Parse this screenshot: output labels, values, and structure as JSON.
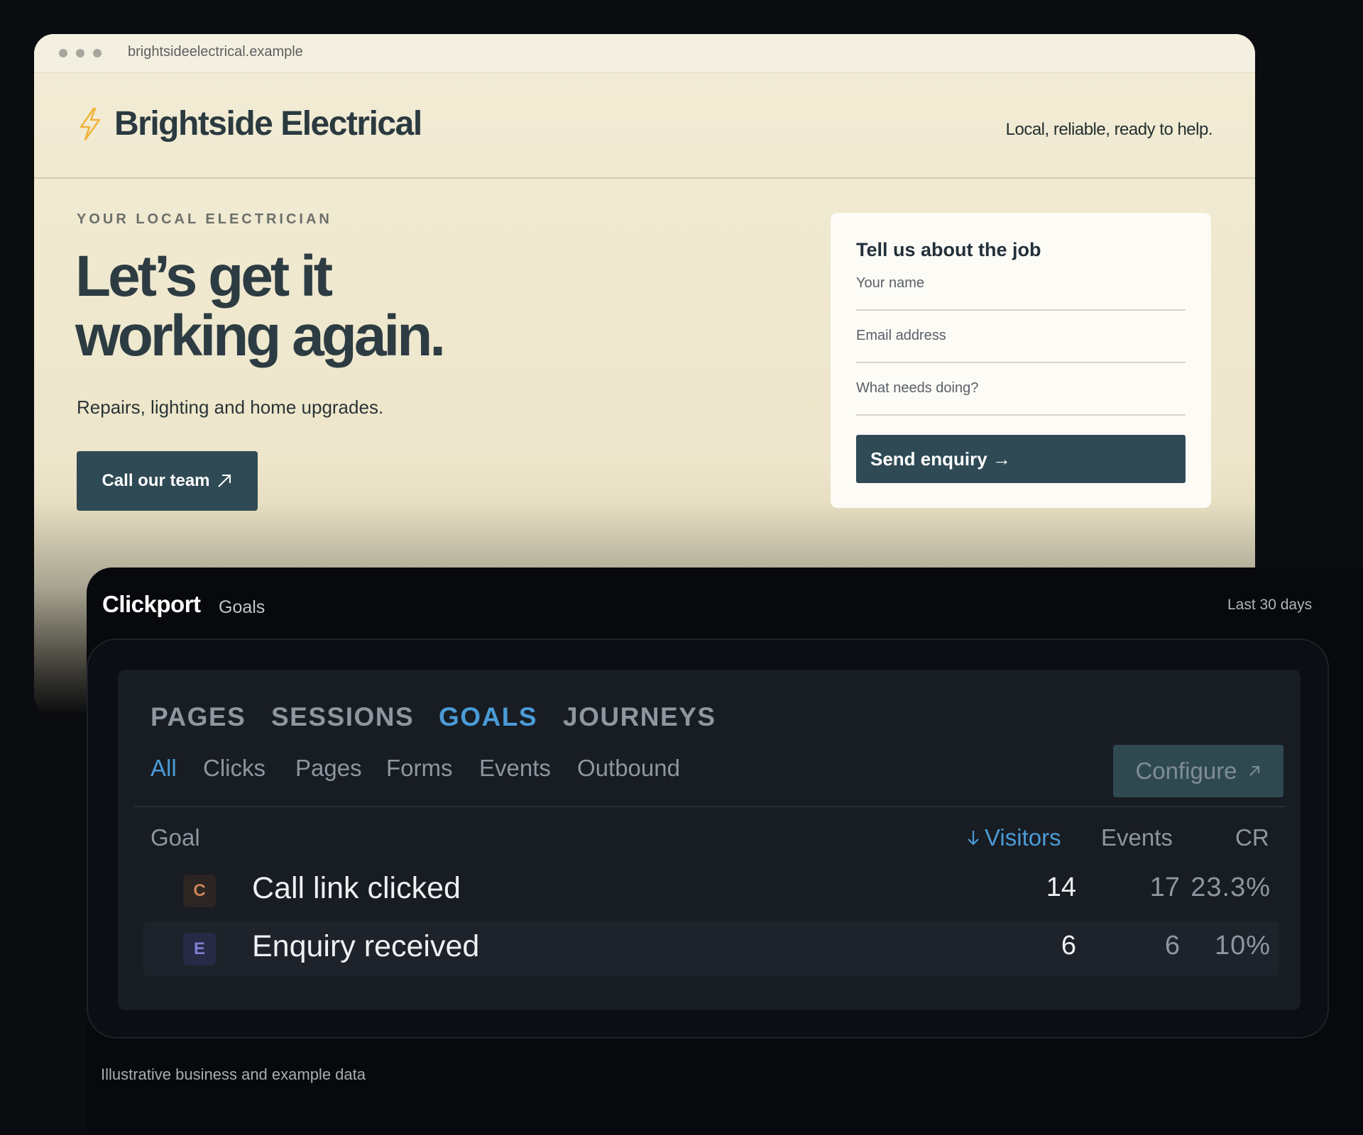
{
  "browser": {
    "url": "brightsideelectrical.example"
  },
  "site": {
    "brand": "Brightside Electrical",
    "tagline": "Local, reliable, ready to help.",
    "eyebrow": "YOUR LOCAL ELECTRICIAN",
    "hero_line1": "Let’s get it",
    "hero_line2": "working again.",
    "subtitle": "Repairs, lighting and home upgrades.",
    "cta_label": "Call our team",
    "cta_icon": "arrow-up-right-icon",
    "accent_color": "#f2b23a",
    "button_color": "#2f4a54"
  },
  "form": {
    "title": "Tell us about the job",
    "name_placeholder": "Your name",
    "email_placeholder": "Email address",
    "message_placeholder": "What needs doing?",
    "submit_label": "Send enquiry →"
  },
  "analytics": {
    "app_name": "Clickport",
    "section": "Goals",
    "range": "Last 30 days",
    "tabs": [
      {
        "label": "PAGES",
        "active": false
      },
      {
        "label": "SESSIONS",
        "active": false
      },
      {
        "label": "GOALS",
        "active": true
      },
      {
        "label": "JOURNEYS",
        "active": false
      }
    ],
    "subtabs": [
      {
        "label": "All",
        "active": true
      },
      {
        "label": "Clicks",
        "active": false
      },
      {
        "label": "Pages",
        "active": false
      },
      {
        "label": "Forms",
        "active": false
      },
      {
        "label": "Events",
        "active": false
      },
      {
        "label": "Outbound",
        "active": false
      }
    ],
    "configure_label": "Configure",
    "columns": {
      "goal": "Goal",
      "visitors": "Visitors",
      "events": "Events",
      "cr": "CR"
    },
    "sort_column": "Visitors",
    "rows": [
      {
        "badge": "C",
        "goal": "Call link clicked",
        "visitors": "14",
        "events": "17",
        "cr": "23.3%"
      },
      {
        "badge": "E",
        "goal": "Enquiry received",
        "visitors": "6",
        "events": "6",
        "cr": "10%"
      }
    ],
    "active_color": "#4a9bd6"
  },
  "footnote": "Illustrative business and example data"
}
